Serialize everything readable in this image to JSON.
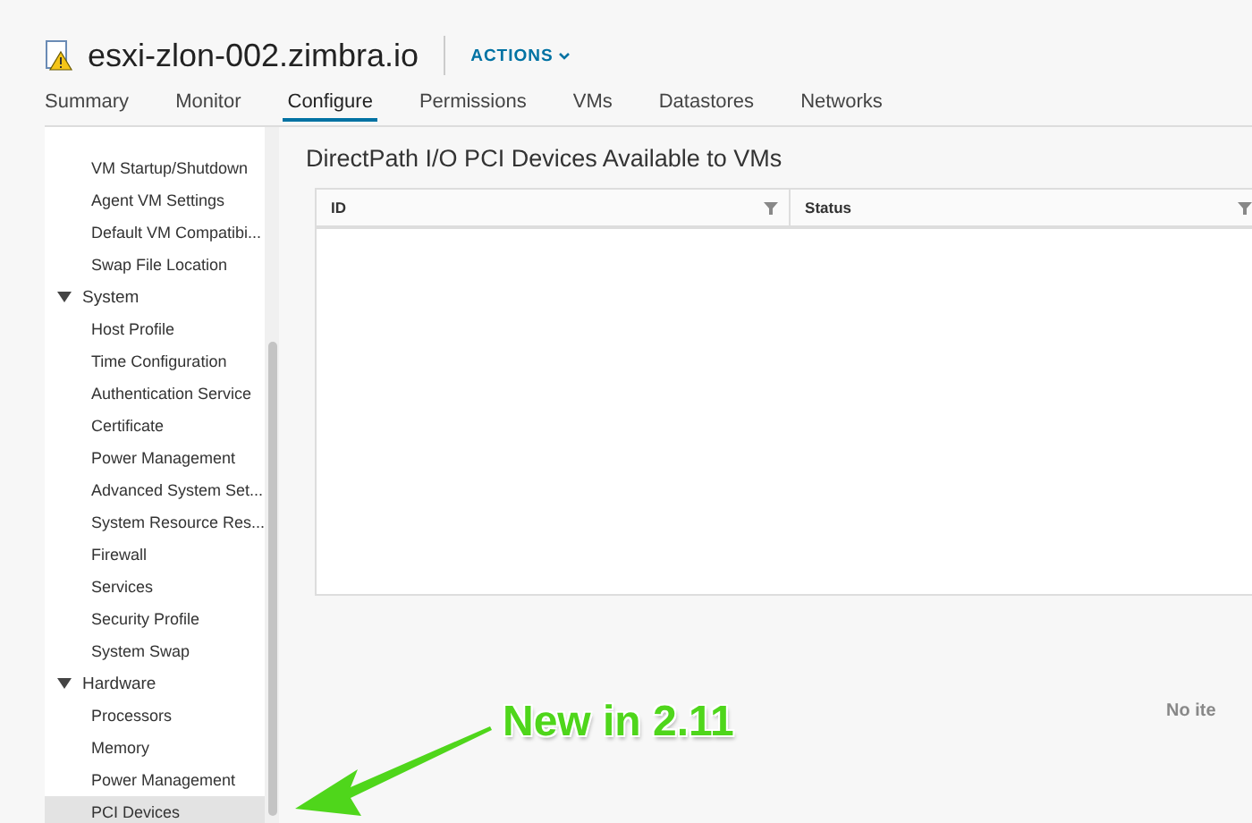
{
  "header": {
    "title": "esxi-zlon-002.zimbra.io",
    "actions": "ACTIONS"
  },
  "tabs": [
    {
      "label": "Summary",
      "selected": false
    },
    {
      "label": "Monitor",
      "selected": false
    },
    {
      "label": "Configure",
      "selected": true
    },
    {
      "label": "Permissions",
      "selected": false
    },
    {
      "label": "VMs",
      "selected": false
    },
    {
      "label": "Datastores",
      "selected": false
    },
    {
      "label": "Networks",
      "selected": false
    }
  ],
  "sidebar": {
    "groups": [
      {
        "children": [
          {
            "label": "VM Startup/Shutdown",
            "selected": false
          },
          {
            "label": "Agent VM Settings",
            "selected": false
          },
          {
            "label": "Default VM Compatibi...",
            "selected": false
          },
          {
            "label": "Swap File Location",
            "selected": false
          }
        ]
      },
      {
        "label": "System",
        "expanded": true,
        "children": [
          {
            "label": "Host Profile",
            "selected": false
          },
          {
            "label": "Time Configuration",
            "selected": false
          },
          {
            "label": "Authentication Service",
            "selected": false
          },
          {
            "label": "Certificate",
            "selected": false
          },
          {
            "label": "Power Management",
            "selected": false
          },
          {
            "label": "Advanced System Set...",
            "selected": false
          },
          {
            "label": "System Resource Res...",
            "selected": false
          },
          {
            "label": "Firewall",
            "selected": false
          },
          {
            "label": "Services",
            "selected": false
          },
          {
            "label": "Security Profile",
            "selected": false
          },
          {
            "label": "System Swap",
            "selected": false
          }
        ]
      },
      {
        "label": "Hardware",
        "expanded": true,
        "children": [
          {
            "label": "Processors",
            "selected": false
          },
          {
            "label": "Memory",
            "selected": false
          },
          {
            "label": "Power Management",
            "selected": false
          },
          {
            "label": "PCI Devices",
            "selected": true
          }
        ]
      }
    ]
  },
  "main": {
    "title": "DirectPath I/O PCI Devices Available to VMs",
    "table": {
      "columns": [
        "ID",
        "Status"
      ]
    },
    "footer": "No ite"
  },
  "annotation": {
    "text": "New in 2.11"
  }
}
